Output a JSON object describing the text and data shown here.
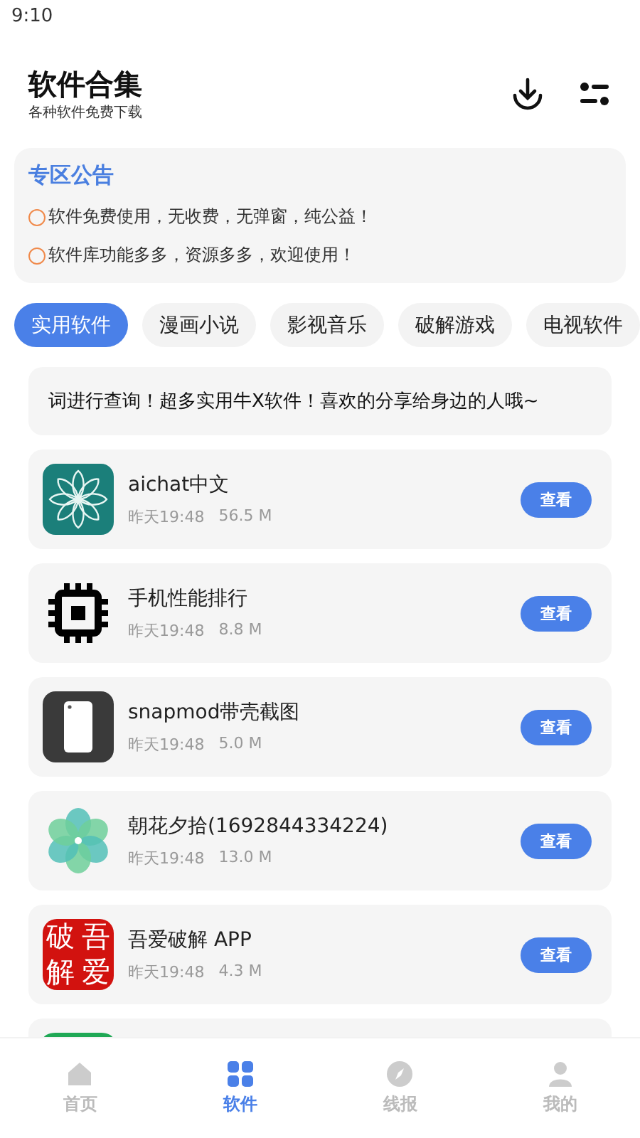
{
  "status_bar": {
    "time": "9:10"
  },
  "header": {
    "title": "软件合集",
    "subtitle": "各种软件免费下载"
  },
  "notice": {
    "title": "专区公告",
    "lines": [
      "软件免费使用，无收费，无弹窗，纯公益！",
      "软件库功能多多，资源多多，欢迎使用！"
    ]
  },
  "tabs": [
    {
      "label": "实用软件",
      "selected": true
    },
    {
      "label": "漫画小说",
      "selected": false
    },
    {
      "label": "影视音乐",
      "selected": false
    },
    {
      "label": "破解游戏",
      "selected": false
    },
    {
      "label": "电视软件",
      "selected": false
    }
  ],
  "marquee": "词进行查询！超多实用牛X软件！喜欢的分享给身边的人哦~",
  "apps": [
    {
      "name": "aichat中文",
      "time": "昨天19:48",
      "size": "56.5 M",
      "button": "查看"
    },
    {
      "name": "手机性能排行",
      "time": "昨天19:48",
      "size": "8.8 M",
      "button": "查看"
    },
    {
      "name": "snapmod带壳截图",
      "time": "昨天19:48",
      "size": "5.0 M",
      "button": "查看"
    },
    {
      "name": "朝花夕拾(1692844334224)",
      "time": "昨天19:48",
      "size": "13.0 M",
      "button": "查看"
    },
    {
      "logo_chars": [
        "破",
        "吾",
        "解",
        "爱"
      ],
      "name": "吾爱破解 APP",
      "time": "昨天19:48",
      "size": "4.3 M",
      "button": "查看"
    }
  ],
  "bottom_nav": [
    {
      "label": "首页",
      "selected": false
    },
    {
      "label": "软件",
      "selected": true
    },
    {
      "label": "线报",
      "selected": false
    },
    {
      "label": "我的",
      "selected": false
    }
  ]
}
